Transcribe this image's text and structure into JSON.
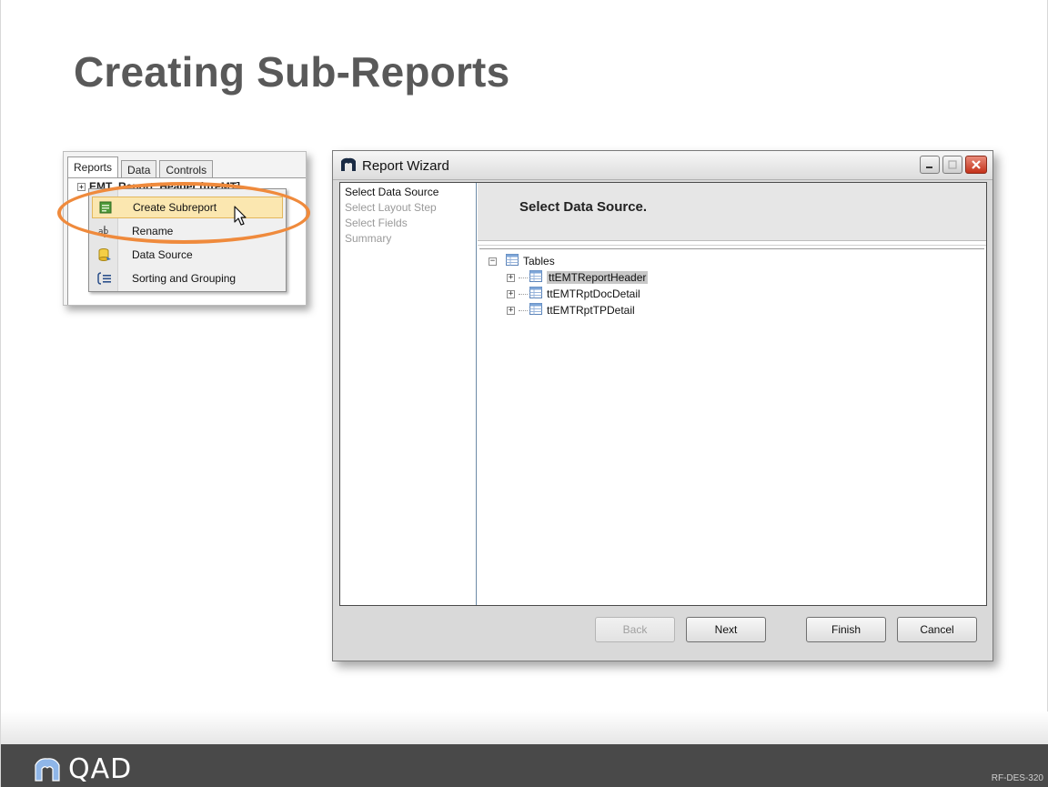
{
  "slide": {
    "title": "Creating Sub-Reports",
    "code": "RF-DES-320"
  },
  "designer": {
    "tabs": [
      {
        "label": "Reports",
        "active": true
      },
      {
        "label": "Data",
        "active": false
      },
      {
        "label": "Controls",
        "active": false
      }
    ],
    "tree_head": "EMT_Report_Header (ttreMT]"
  },
  "context_menu": {
    "items": [
      {
        "label": "Create Subreport",
        "icon": "subreport-icon",
        "hover": true
      },
      {
        "label": "Rename",
        "icon": "rename-icon",
        "hover": false
      },
      {
        "label": "Data Source",
        "icon": "data-source-icon",
        "hover": false
      },
      {
        "label": "Sorting and Grouping",
        "icon": "sorting-grouping-icon",
        "hover": false
      }
    ]
  },
  "wizard": {
    "title": "Report Wizard",
    "steps": [
      {
        "label": "Select Data Source",
        "current": true
      },
      {
        "label": "Select Layout Step",
        "current": false
      },
      {
        "label": "Select Fields",
        "current": false
      },
      {
        "label": "Summary",
        "current": false
      }
    ],
    "header_title": "Select Data Source.",
    "tree": {
      "root": "Tables",
      "children": [
        "ttEMTReportHeader",
        "ttEMTRptDocDetail",
        "ttEMTRptTPDetail"
      ]
    },
    "buttons": {
      "back": "Back",
      "next": "Next",
      "finish": "Finish",
      "cancel": "Cancel"
    }
  },
  "footer": {
    "logo_text": "QAD"
  },
  "colors": {
    "highlight_ring": "#ef8a3c",
    "footer_band": "#494949",
    "title": "#595959"
  }
}
